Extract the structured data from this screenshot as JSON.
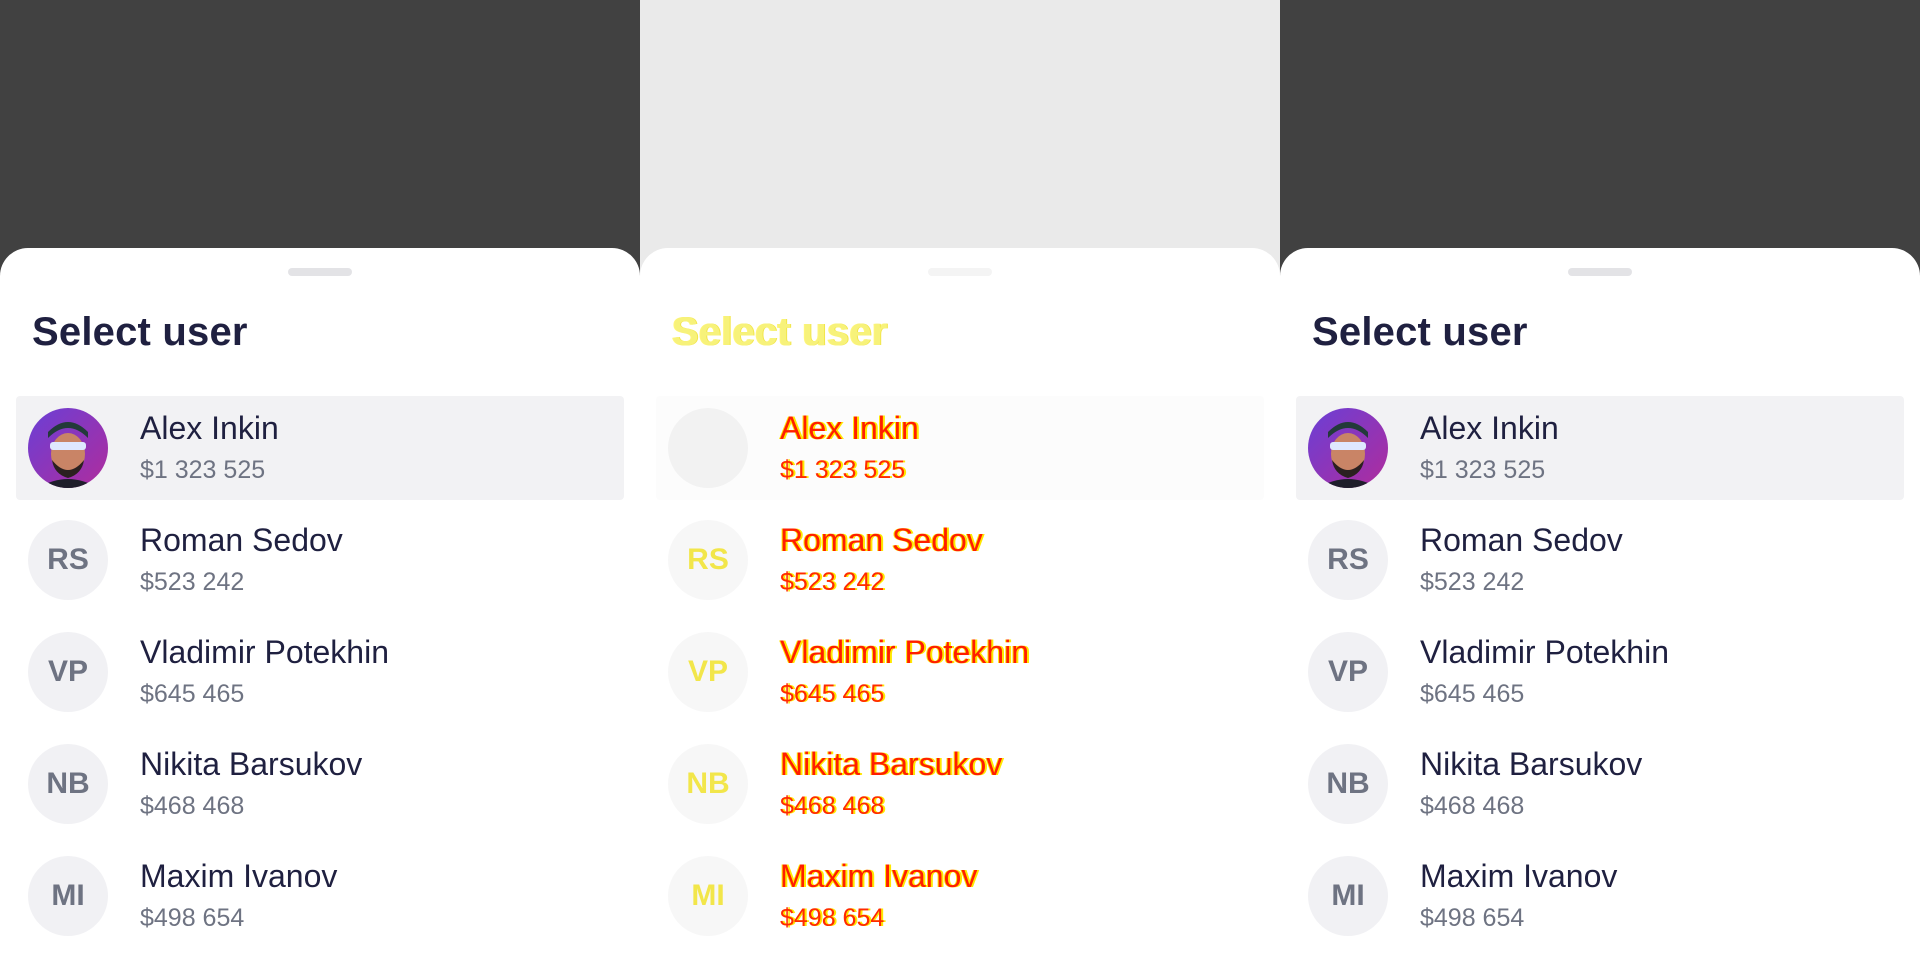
{
  "sheet": {
    "title": "Select user"
  },
  "users": [
    {
      "name": "Alex Inkin",
      "balance": "$1 323 525",
      "initials": "",
      "avatar": "photo",
      "selected": true
    },
    {
      "name": "Roman Sedov",
      "balance": "$523 242",
      "initials": "RS",
      "avatar": "initials",
      "selected": false
    },
    {
      "name": "Vladimir Potekhin",
      "balance": "$645 465",
      "initials": "VP",
      "avatar": "initials",
      "selected": false
    },
    {
      "name": "Nikita Barsukov",
      "balance": "$468 468",
      "initials": "NB",
      "avatar": "initials",
      "selected": false
    },
    {
      "name": "Maxim Ivanov",
      "balance": "$498 654",
      "initials": "MI",
      "avatar": "initials",
      "selected": false
    }
  ],
  "colors": {
    "backdrop_dark": "#414141",
    "backdrop_light": "#eaeaea",
    "title": "#1f2040",
    "secondary": "#6e7382",
    "selected_row": "#f2f2f4",
    "avatar_bg": "#f1f1f4"
  },
  "icons": {
    "photo_avatar": "user-photo-avatar"
  }
}
